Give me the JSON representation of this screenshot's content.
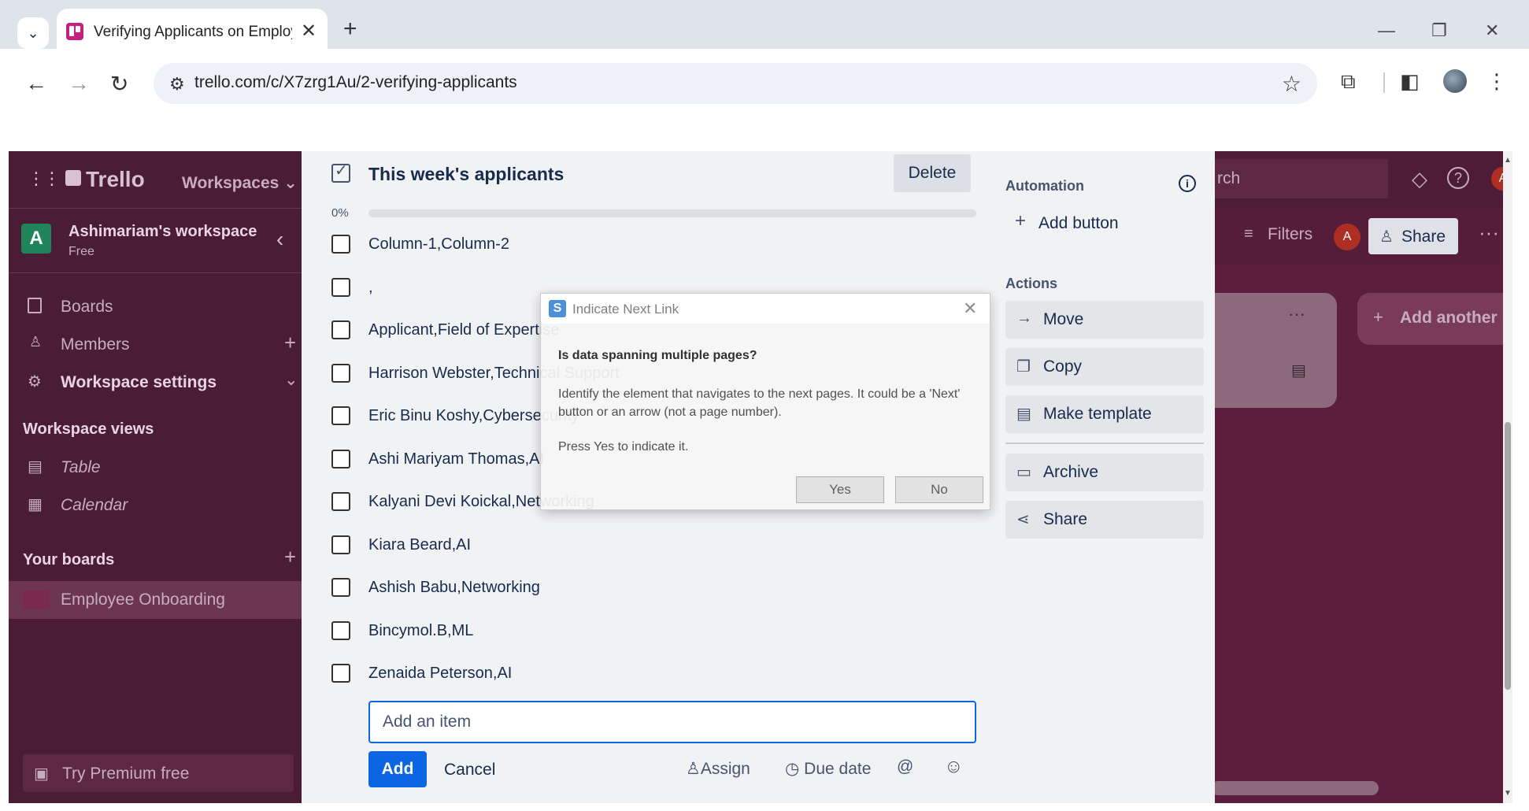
{
  "browser": {
    "tab_title": "Verifying Applicants on Employ",
    "url": "trello.com/c/X7zrg1Au/2-verifying-applicants",
    "glyphs": {
      "tab_search": "⌄",
      "close": "✕",
      "new_tab": "+",
      "minimize": "—",
      "restore": "❐",
      "back": "←",
      "forward": "→",
      "reload": "↻",
      "site_info": "⚙",
      "star": "☆",
      "extensions": "⧉",
      "split": "◧",
      "menu": "⋮"
    }
  },
  "trello": {
    "logo": "Trello",
    "workspaces": "Workspaces",
    "search_partial": "rch",
    "workspace_name": "Ashimariam's workspace",
    "workspace_plan": "Free",
    "workspace_initial": "A",
    "user_initial": "A",
    "nav": {
      "boards": "Boards",
      "members": "Members",
      "workspace_settings": "Workspace settings"
    },
    "workspace_views_heading": "Workspace views",
    "views": {
      "table": "Table",
      "calendar": "Calendar"
    },
    "your_boards_heading": "Your boards",
    "board_name": "Employee Onboarding",
    "premium": "Try Premium free",
    "filters": "Filters",
    "share": "Share",
    "add_another_list": "Add another list",
    "glyphs": {
      "apps": "⋮⋮⋮",
      "more": "···",
      "plus": "+",
      "chevron_left": "‹",
      "chevron_down": "⌄",
      "help": "?",
      "bell": "◇"
    }
  },
  "checklist": {
    "title": "This week's applicants",
    "delete_label": "Delete",
    "progress_text": "0%",
    "progress_value": 0,
    "items": [
      "Column-1,Column-2",
      ",",
      "Applicant,Field of Expertise",
      "Harrison Webster,Technical Support",
      "Eric Binu Koshy,Cybersecurity",
      "Ashi Mariyam Thomas,AI",
      "Kalyani Devi Koickal,Networking",
      "Kiara Beard,AI",
      "Ashish Babu,Networking",
      "Bincymol.B,ML",
      "Zenaida Peterson,AI"
    ],
    "add_item_placeholder": "Add an item",
    "add_label": "Add",
    "cancel_label": "Cancel",
    "assign_label": "Assign",
    "due_date_label": "Due date",
    "mention_glyph": "@",
    "emoji_glyph": "☺"
  },
  "card_sidebar": {
    "automation_heading": "Automation",
    "add_button": "Add button",
    "actions_heading": "Actions",
    "actions": [
      {
        "label": "Move",
        "icon": "→"
      },
      {
        "label": "Copy",
        "icon": "❐"
      },
      {
        "label": "Make template",
        "icon": "▤"
      },
      {
        "label": "Archive",
        "icon": "▭"
      },
      {
        "label": "Share",
        "icon": "⋖"
      }
    ]
  },
  "dialog": {
    "title": "Indicate Next Link",
    "app_icon": "S",
    "question": "Is data spanning multiple pages?",
    "body": "Identify the element that navigates to the next pages. It could be a 'Next' button or an arrow (not a page number).",
    "instruction": "Press Yes to indicate it.",
    "yes_label": "Yes",
    "no_label": "No"
  },
  "colors": {
    "brand_blue": "#0c66e4",
    "trello_bg": "#5a1f3e",
    "sidebar_bg": "#4a1c35"
  }
}
